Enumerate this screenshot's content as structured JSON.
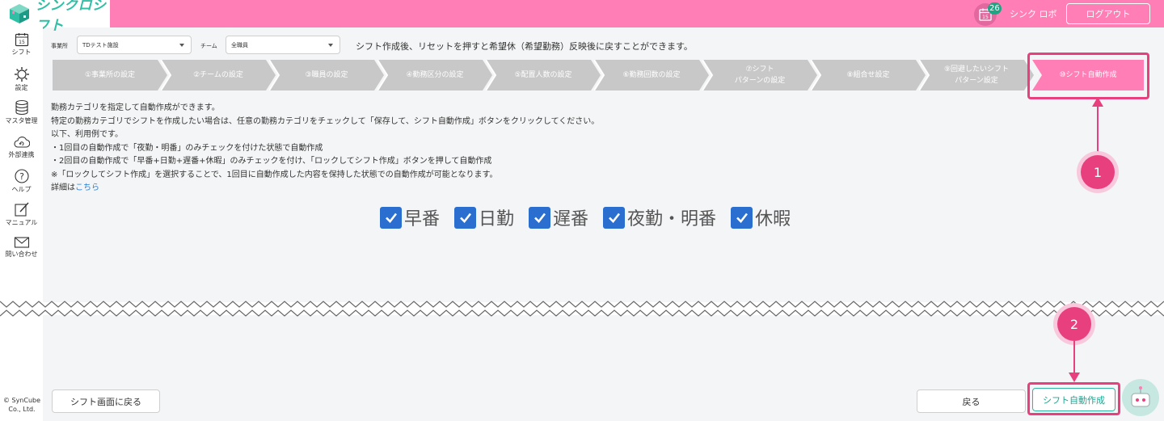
{
  "app": {
    "title": "シンクロシフト"
  },
  "header": {
    "calendar_day": "15",
    "notification_count": "26",
    "user_name": "シンク ロボ",
    "logout_label": "ログアウト"
  },
  "sidebar": {
    "items": [
      {
        "label": "シフト",
        "icon": "calendar-icon"
      },
      {
        "label": "設定",
        "icon": "gear-icon"
      },
      {
        "label": "マスタ管理",
        "icon": "database-icon"
      },
      {
        "label": "外部連携",
        "icon": "cloud-sync-icon"
      },
      {
        "label": "ヘルプ",
        "icon": "help-icon"
      },
      {
        "label": "マニュアル",
        "icon": "edit-icon"
      },
      {
        "label": "問い合わせ",
        "icon": "mail-icon"
      }
    ],
    "calendar_day": "15",
    "copyright_1": "© SynCube",
    "copyright_2": "Co., Ltd."
  },
  "filters": {
    "office_label": "事業所",
    "office_value": "TDテスト施設",
    "team_label": "チーム",
    "team_value": "全職員"
  },
  "info_text": "シフト作成後、リセットを押すと希望休（希望勤務）反映後に戻すことができます。",
  "steps": [
    {
      "line1": "①事業所の設定",
      "line2": ""
    },
    {
      "line1": "②チームの設定",
      "line2": ""
    },
    {
      "line1": "③職員の設定",
      "line2": ""
    },
    {
      "line1": "④勤務区分の設定",
      "line2": ""
    },
    {
      "line1": "⑤配置人数の設定",
      "line2": ""
    },
    {
      "line1": "⑥勤務回数の設定",
      "line2": ""
    },
    {
      "line1": "⑦シフト",
      "line2": "パターンの設定"
    },
    {
      "line1": "⑧組合せ設定",
      "line2": ""
    },
    {
      "line1": "⑨回避したいシフト",
      "line2": "パターン設定"
    },
    {
      "line1": "⑩シフト自動作成",
      "line2": ""
    }
  ],
  "description": {
    "line1": "勤務カテゴリを指定して自動作成ができます。",
    "line2": "特定の勤務カテゴリでシフトを作成したい場合は、任意の勤務カテゴリをチェックして「保存して、シフト自動作成」ボタンをクリックしてください。",
    "line3": "以下、利用例です。",
    "line4": "・1回目の自動作成で「夜勤・明番」のみチェックを付けた状態で自動作成",
    "line5": "・2回目の自動作成で「早番+日勤+遅番+休暇」のみチェックを付け、「ロックしてシフト作成」ボタンを押して自動作成",
    "line6": "※「ロックしてシフト作成」を選択することで、1回目に自動作成した内容を保持した状態での自動作成が可能となります。",
    "detail_prefix": "詳細は",
    "detail_link": "こちら"
  },
  "categories": [
    {
      "label": "早番",
      "checked": true
    },
    {
      "label": "日勤",
      "checked": true
    },
    {
      "label": "遅番",
      "checked": true
    },
    {
      "label": "夜勤・明番",
      "checked": true
    },
    {
      "label": "休暇",
      "checked": true
    }
  ],
  "callouts": {
    "one": "1",
    "two": "2"
  },
  "buttons": {
    "back_to_shift": "シフト画面に戻る",
    "back": "戻る",
    "auto_create": "シフト自動作成"
  },
  "colors": {
    "header": "#ff7eb6",
    "active_step": "#ff7eb6",
    "inactive_step": "#c8c8c8",
    "checkbox": "#2a6fd0",
    "callout": "#e8407e",
    "brand": "#2fbfa5"
  }
}
